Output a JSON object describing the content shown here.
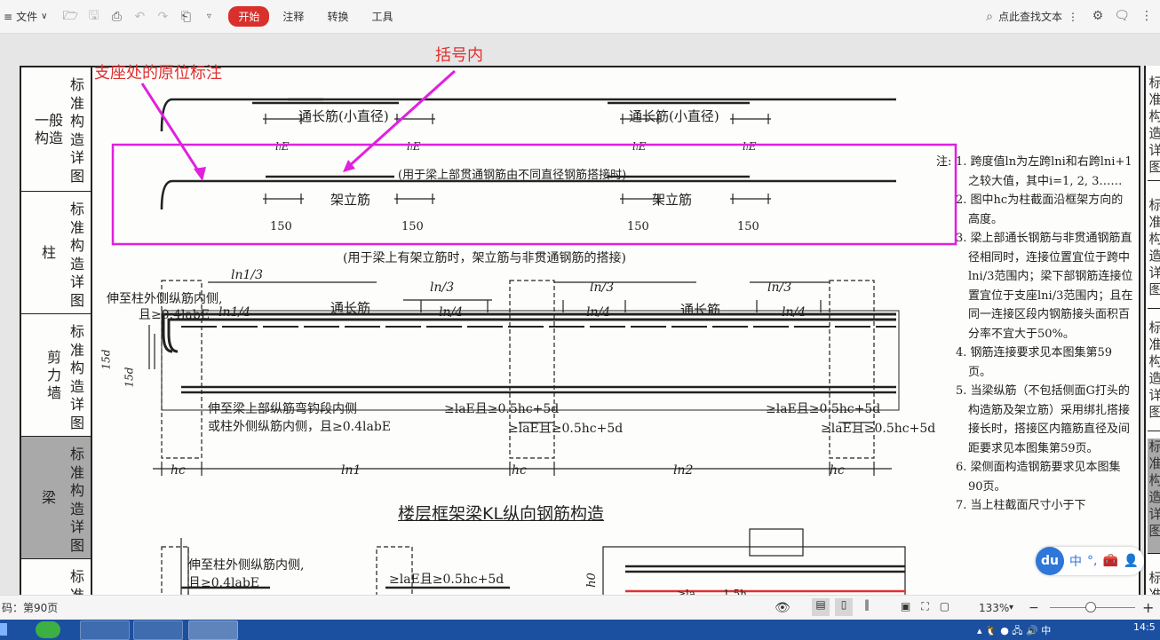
{
  "toolbar": {
    "file_label": "文件",
    "tabs": [
      "开始",
      "注释",
      "转换",
      "工具"
    ],
    "search_label": "点此查找文本",
    "accent": "#d9302c"
  },
  "sidebar": {
    "sections": [
      {
        "big": "一般构造",
        "vert": "标准构造详图"
      },
      {
        "big": "柱",
        "vert": "标准构造详图"
      },
      {
        "big": "剪力墙",
        "vert": "标准构造详图"
      },
      {
        "big": "梁",
        "vert": "标准构造详图"
      },
      {
        "big": "",
        "vert": "标准"
      }
    ]
  },
  "right_side": [
    "标准构造详图",
    "标准构造详图",
    "标准构造详图",
    "标准构造详图",
    "标准"
  ],
  "annotations": {
    "support_note": "支座处的原位标注",
    "bracket_note": "括号内"
  },
  "drawing": {
    "top_rebar_left": "通长筋(小直径)",
    "top_rebar_right": "通长筋(小直径)",
    "lap_labels": [
      "lₗE",
      "lₗE",
      "lₗE",
      "lₗE"
    ],
    "caption1": "(用于梁上部贯通钢筋由不同直径钢筋搭接时)",
    "erect_left": "架立筋",
    "erect_right": "架立筋",
    "lap150": [
      "150",
      "150",
      "150",
      "150"
    ],
    "caption2": "(用于梁上有架立筋时，架立筋与非贯通钢筋的搭接)",
    "ln1_3": "ln1/3",
    "col_note1": "伸至柱外侧纵筋内侧,",
    "col_note2": "且≥0.4labE",
    "ln1_4": "ln1/4",
    "through_bar": "通长筋",
    "ln3a": "ln/3",
    "ln4a": "ln/4",
    "ln3b": "ln/3",
    "ln4b": "ln/4",
    "through_bar2": "通长筋",
    "ln3c": "ln/3",
    "ln4c": "ln/4",
    "d15": "15d",
    "d15b": "15d",
    "beam_note1": "伸至梁上部纵筋弯钩段内侧",
    "beam_note2": "或柱外侧纵筋内侧，且≥0.4labE",
    "anchor1": "≥laE且≥0.5hc+5d",
    "anchor2": "≥laE且≥0.5hc+5d",
    "anchor3": "≥laE且≥0.5hc+5d",
    "anchor4": "≥laE且≥0.5hc+5d",
    "hc1": "hc",
    "ln1": "ln1",
    "hc2": "hc",
    "ln2": "ln2",
    "hc3": "hc",
    "main_title": "楼层框架梁KL纵向钢筋构造",
    "bottom_note1": "伸至柱外侧纵筋内侧,",
    "bottom_note2": "且≥0.4labE",
    "bottom_anchor": "≥laE且≥0.5hc+5d",
    "h0": "h0",
    "bottom_lap": "≥la",
    "bottom_lap2": "1.5h"
  },
  "notes": {
    "label": "注:",
    "items": [
      "1. 跨度值ln为左跨lni和右跨lni+1之较大值，其中i=1, 2, 3……",
      "2. 图中hc为柱截面沿框架方向的高度。",
      "3. 梁上部通长钢筋与非贯通钢筋直径相同时，连接位置宜位于跨中lni/3范围内；梁下部钢筋连接位置宜位于支座lni/3范围内；且在同一连接区段内钢筋接头面积百分率不宜大于50%。",
      "4. 钢筋连接要求见本图集第59页。",
      "5. 当梁纵筋（不包括侧面G打头的构造筋及架立筋）采用绑扎搭接接长时，搭接区内箍筋直径及间距要求见本图集第59页。",
      "6. 梁侧面构造钢筋要求见本图集90页。",
      "7. 当上柱截面尺寸小于下"
    ]
  },
  "ime": {
    "logo": "du",
    "lang": "中",
    "punct": "°,"
  },
  "status": {
    "page_label": "码：第90页",
    "zoom": "133%",
    "zoom_minus": "−",
    "zoom_plus": "+"
  },
  "clock": "14:5"
}
